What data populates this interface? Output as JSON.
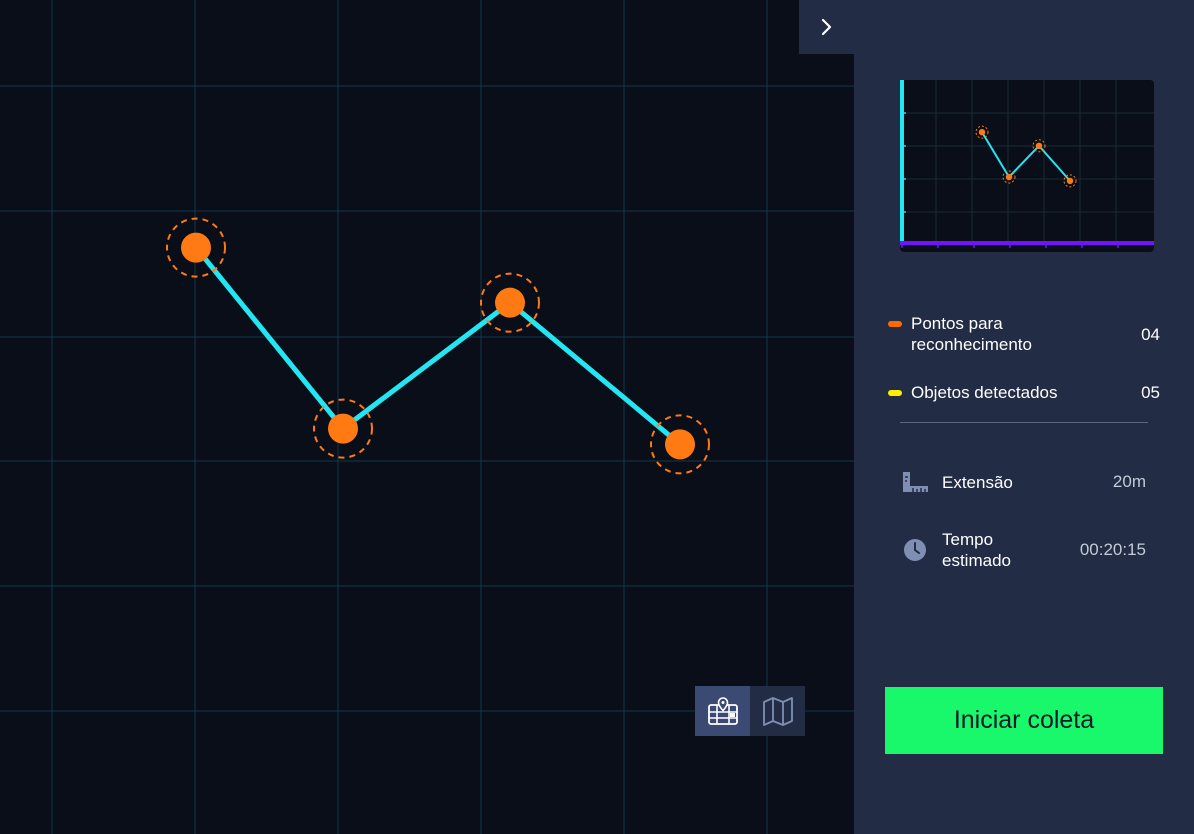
{
  "map": {
    "route_points": [
      {
        "x": 1,
        "y": 4.3
      },
      {
        "x": 2,
        "y": 2.0
      },
      {
        "x": 3,
        "y": 3.6
      },
      {
        "x": 4,
        "y": 1.8
      }
    ],
    "colors": {
      "background": "#090e19",
      "grid": "#14384a",
      "route": "#22e6f2",
      "point": "#ff7a12"
    }
  },
  "mini_chart": {
    "colors": {
      "y_axis": "#22e6f2",
      "x_axis": "#7014ff",
      "route": "#22e6f2",
      "point": "#ff7a12"
    }
  },
  "legend": [
    {
      "label": "Pontos para reconhecimento",
      "value": "04",
      "color": "#ff6a00"
    },
    {
      "label": "Objetos detectados",
      "value": "05",
      "color": "#ffee00"
    }
  ],
  "stats": {
    "extent": {
      "label": "Extensão",
      "value": "20m",
      "icon": "ruler-icon"
    },
    "time": {
      "label": "Tempo estimado",
      "value": "00:20:15",
      "icon": "clock-icon"
    }
  },
  "actions": {
    "start_label": "Iniciar coleta",
    "collapse_icon": "chevron-right-icon",
    "view_toggle": [
      "grid-map-icon",
      "map-icon"
    ]
  }
}
